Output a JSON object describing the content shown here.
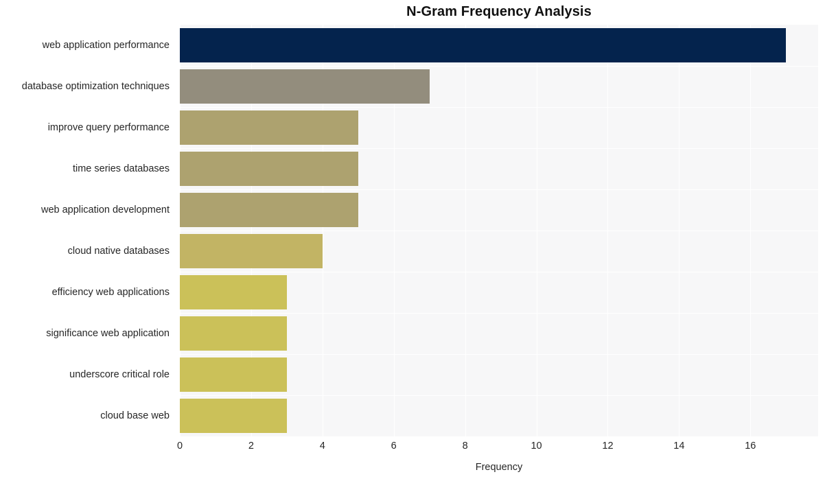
{
  "chart_data": {
    "type": "bar",
    "orientation": "horizontal",
    "title": "N-Gram Frequency Analysis",
    "xlabel": "Frequency",
    "ylabel": "",
    "categories": [
      "web application performance",
      "database optimization techniques",
      "improve query performance",
      "time series databases",
      "web application development",
      "cloud native databases",
      "efficiency web applications",
      "significance web application",
      "underscore critical role",
      "cloud base web"
    ],
    "values": [
      17,
      7,
      5,
      5,
      5,
      4,
      3,
      3,
      3,
      3
    ],
    "bar_colors": [
      "#04234d",
      "#938d7d",
      "#ada26f",
      "#ada26f",
      "#ada26f",
      "#c2b464",
      "#cbc159",
      "#cbc159",
      "#cbc159",
      "#cbc159"
    ],
    "xlim": [
      0,
      17.9
    ],
    "xticks": [
      0,
      2,
      4,
      6,
      8,
      10,
      12,
      14,
      16
    ],
    "xtick_labels": [
      "0",
      "2",
      "4",
      "6",
      "8",
      "10",
      "12",
      "14",
      "16"
    ],
    "grid": true,
    "grid_color": "#ffffff",
    "plot_background": "#f7f7f8",
    "figure_background": "#ffffff",
    "legend": null,
    "text_color": "#262626",
    "title_color": "#111111"
  }
}
